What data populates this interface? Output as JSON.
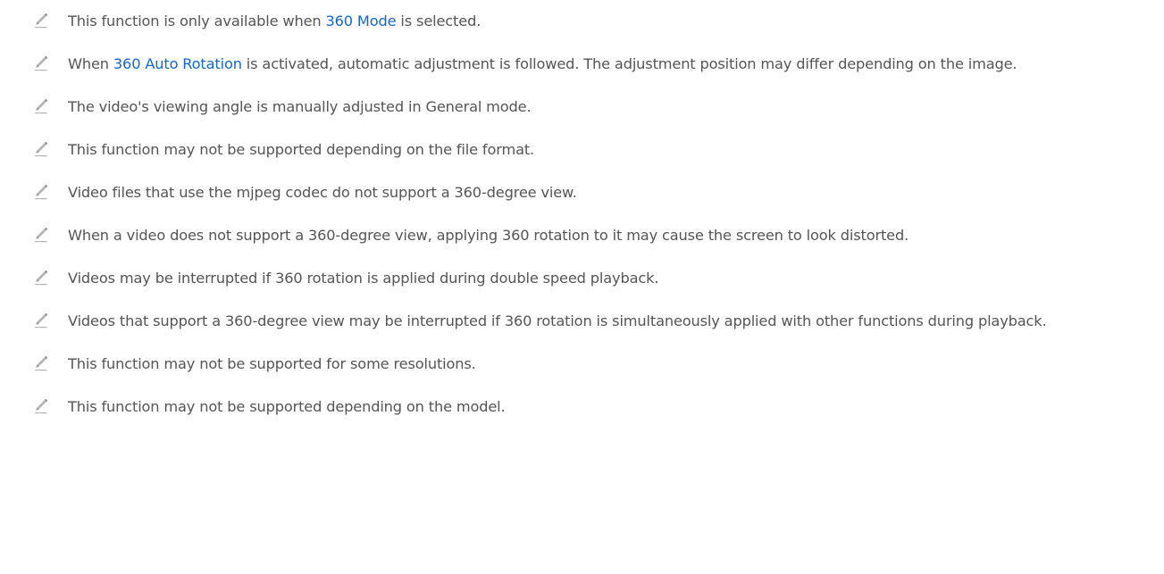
{
  "icon": "pencil-icon",
  "link_color": "#1467c8",
  "notes": [
    {
      "parts": [
        "This function is only available when ",
        "360 Mode",
        " is selected."
      ]
    },
    {
      "parts": [
        "When ",
        "360 Auto Rotation",
        " is activated, automatic adjustment is followed. The adjustment position may differ depending on the image."
      ]
    },
    {
      "text": "The video's viewing angle is manually adjusted in General mode."
    },
    {
      "text": "This function may not be supported depending on the file format."
    },
    {
      "text": "Video files that use the mjpeg codec do not support a 360-degree view."
    },
    {
      "text": "When a video does not support a 360-degree view, applying 360 rotation to it may cause the screen to look distorted."
    },
    {
      "text": "Videos may be interrupted if 360 rotation is applied during double speed playback."
    },
    {
      "text": "Videos that support a 360-degree view may be interrupted if 360 rotation is simultaneously applied with other functions during playback."
    },
    {
      "text": "This function may not be supported for some resolutions."
    },
    {
      "text": "This function may not be supported depending on the model."
    }
  ]
}
